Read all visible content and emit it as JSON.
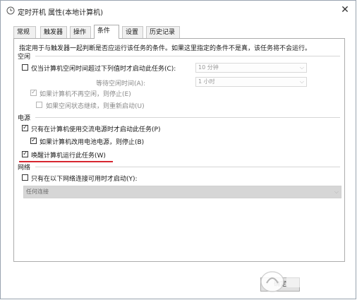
{
  "window": {
    "title": "定时开机 属性(本地计算机)",
    "close_glyph": "✕"
  },
  "tabs": [
    {
      "label": "常规"
    },
    {
      "label": "触发器"
    },
    {
      "label": "操作"
    },
    {
      "label": "条件",
      "active": true
    },
    {
      "label": "设置"
    },
    {
      "label": "历史记录"
    }
  ],
  "panel": {
    "description": "指定用于与触发器一起判断是否应运行该任务的条件。如果这里指定的条件不是真，该任务将不会运行。",
    "idle": {
      "header": "空闲",
      "only_if_idle": {
        "label": "仅当计算机空闲时间超过下列值时才启动此任务(C):",
        "checked": false
      },
      "only_if_idle_value": "10 分钟",
      "wait_label": "等待空闲时间(A):",
      "wait_value": "1 小时",
      "stop_if_not_idle": {
        "label": "如果计算机不再空闲，则停止(E)",
        "checked": true,
        "disabled": true
      },
      "restart_if_idle": {
        "label": "如果空闲状态继续，则重新启动(U)",
        "checked": false,
        "disabled": true
      }
    },
    "power": {
      "header": "电源",
      "ac_only": {
        "label": "只有在计算机使用交流电源时才启动此任务(P)",
        "checked": true
      },
      "stop_on_battery": {
        "label": "如果计算机改用电池电源，则停止(B)",
        "checked": true
      },
      "wake": {
        "label": "唤醒计算机运行此任务(W)",
        "checked": true
      }
    },
    "network": {
      "header": "网络",
      "only_if_network": {
        "label": "只有在以下网络连接可用时才启动(Y):",
        "checked": false
      },
      "connection_value": "任何连接"
    }
  },
  "footer": {
    "ok_label": "确定"
  },
  "colors": {
    "highlight_underline": "#d72630"
  }
}
